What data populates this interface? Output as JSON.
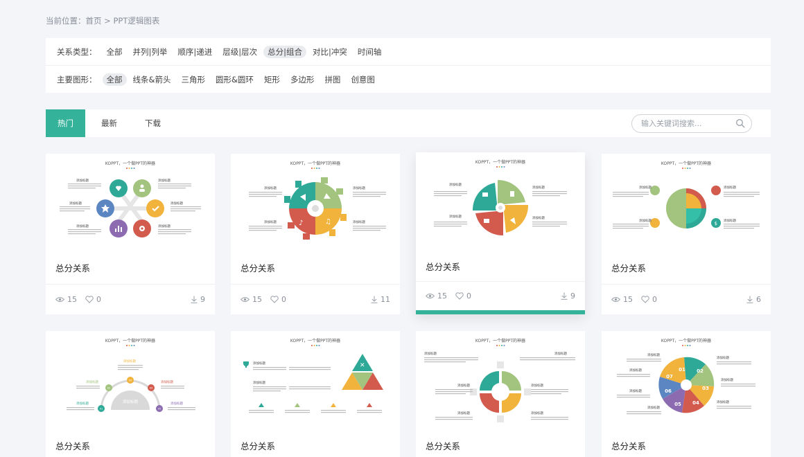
{
  "breadcrumb": "当前位置：首页 > PPT逻辑图表",
  "filters": {
    "type_label": "关系类型：",
    "type_options": [
      "全部",
      "并列|列举",
      "顺序|递进",
      "层级|层次",
      "总分|组合",
      "对比|冲突",
      "时间轴"
    ],
    "type_selected": "总分|组合",
    "shape_label": "主要图形：",
    "shape_options": [
      "全部",
      "线条&箭头",
      "三角形",
      "圆形&圆环",
      "矩形",
      "多边形",
      "拼图",
      "创意图"
    ],
    "shape_selected": "全部"
  },
  "tabs": [
    "热门",
    "最新",
    "下载"
  ],
  "active_tab": "热门",
  "search": {
    "placeholder": "输入关键词搜索..."
  },
  "thumb_header": "KOPPT，一个做PPT的神器",
  "thumb_label": "添加标题",
  "thumb_center_label": "添加标题",
  "cards": [
    {
      "title": "总分关系",
      "views": "15",
      "likes": "0",
      "downloads": "9"
    },
    {
      "title": "总分关系",
      "views": "15",
      "likes": "0",
      "downloads": "11"
    },
    {
      "title": "总分关系",
      "views": "15",
      "likes": "0",
      "downloads": "9"
    },
    {
      "title": "总分关系",
      "views": "15",
      "likes": "0",
      "downloads": "6"
    },
    {
      "title": "总分关系"
    },
    {
      "title": "总分关系"
    },
    {
      "title": "总分关系"
    },
    {
      "title": "总分关系"
    }
  ],
  "step_numbers": [
    "01",
    "02",
    "03",
    "04",
    "05",
    "06",
    "07"
  ],
  "colors": {
    "accent": "#34b29a",
    "green": "#a3c47f",
    "yellow": "#f1b33c",
    "red": "#d35b4e",
    "teal": "#2fa997",
    "purple": "#8c6bb1",
    "blue": "#5b86c2"
  }
}
